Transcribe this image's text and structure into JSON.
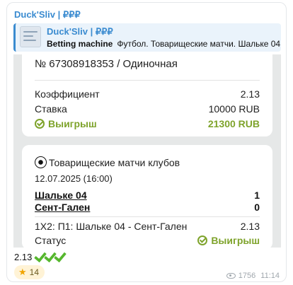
{
  "message": {
    "sender": "Duck'Sliv | ₽₽₽",
    "reply": {
      "title": "Duck'Sliv | ₽₽₽",
      "source": "Betting machine",
      "preview": "Футбол. Товарищеские матчи.  Шальке 04"
    },
    "bet_card": {
      "title": "№ 67308918353 / Одиночная",
      "coef_label": "Коэффициент",
      "coef_value": "2.13",
      "stake_label": "Ставка",
      "stake_value": "10000 RUB",
      "result_label": "Выигрыш",
      "result_value": "21300 RUB"
    },
    "match_card": {
      "title": "Товарищеские матчи клубов",
      "date": "12.07.2025 (16:00)",
      "teams": [
        {
          "name": "Шальке 04",
          "score": "1"
        },
        {
          "name": "Сент-Гален",
          "score": "0"
        }
      ],
      "market": "1X2: П1: Шальке 04 - Сент-Гален",
      "market_coef": "2.13",
      "status_label": "Статус",
      "status_value": "Выигрыш"
    },
    "text": "2.13",
    "reaction": {
      "emoji": "star",
      "count": "14"
    },
    "views": "1756",
    "time": "11:14",
    "colors": {
      "accent": "#3a8bd0",
      "win": "#7ea32b",
      "check": "#56b72e"
    }
  }
}
